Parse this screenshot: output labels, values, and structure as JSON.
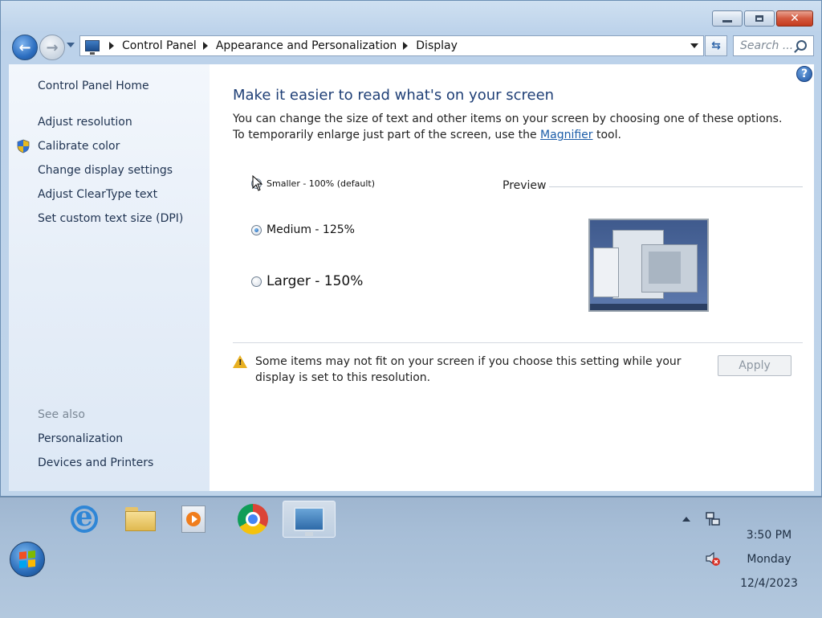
{
  "window": {
    "caption": {
      "minimize": "minimize",
      "maximize": "maximize",
      "close": "✕"
    }
  },
  "nav": {
    "breadcrumbs": [
      "Control Panel",
      "Appearance and Personalization",
      "Display"
    ],
    "search_placeholder": "Search ..."
  },
  "sidebar": {
    "home": "Control Panel Home",
    "links": [
      "Adjust resolution",
      "Calibrate color",
      "Change display settings",
      "Adjust ClearType text",
      "Set custom text size (DPI)"
    ],
    "see_also_title": "See also",
    "see_also": [
      "Personalization",
      "Devices and Printers"
    ]
  },
  "main": {
    "heading": "Make it easier to read what's on your screen",
    "desc_before": "You can change the size of text and other items on your screen by choosing one of these options. To temporarily enlarge just part of the screen, use the ",
    "desc_link": "Magnifier",
    "desc_after": " tool.",
    "options": [
      {
        "label": "Smaller - 100% (default)",
        "checked": false
      },
      {
        "label": "Medium - 125%",
        "checked": true
      },
      {
        "label": "Larger - 150%",
        "checked": false
      }
    ],
    "preview_label": "Preview",
    "warning": "Some items may not fit on your screen if you choose this setting while your display is set to this resolution.",
    "apply": "Apply",
    "help": "?"
  },
  "taskbar": {
    "apps": [
      "internet-explorer",
      "windows-explorer",
      "windows-media-player",
      "google-chrome",
      "display-control-panel"
    ],
    "active_app": "display-control-panel",
    "clock": {
      "time": "3:50 PM",
      "day": "Monday",
      "date": "12/4/2023"
    }
  },
  "colors": {
    "heading": "#1f3f76",
    "link": "#1a5ca8",
    "warning": "#e8b021",
    "accent": "#2a6bb8"
  }
}
